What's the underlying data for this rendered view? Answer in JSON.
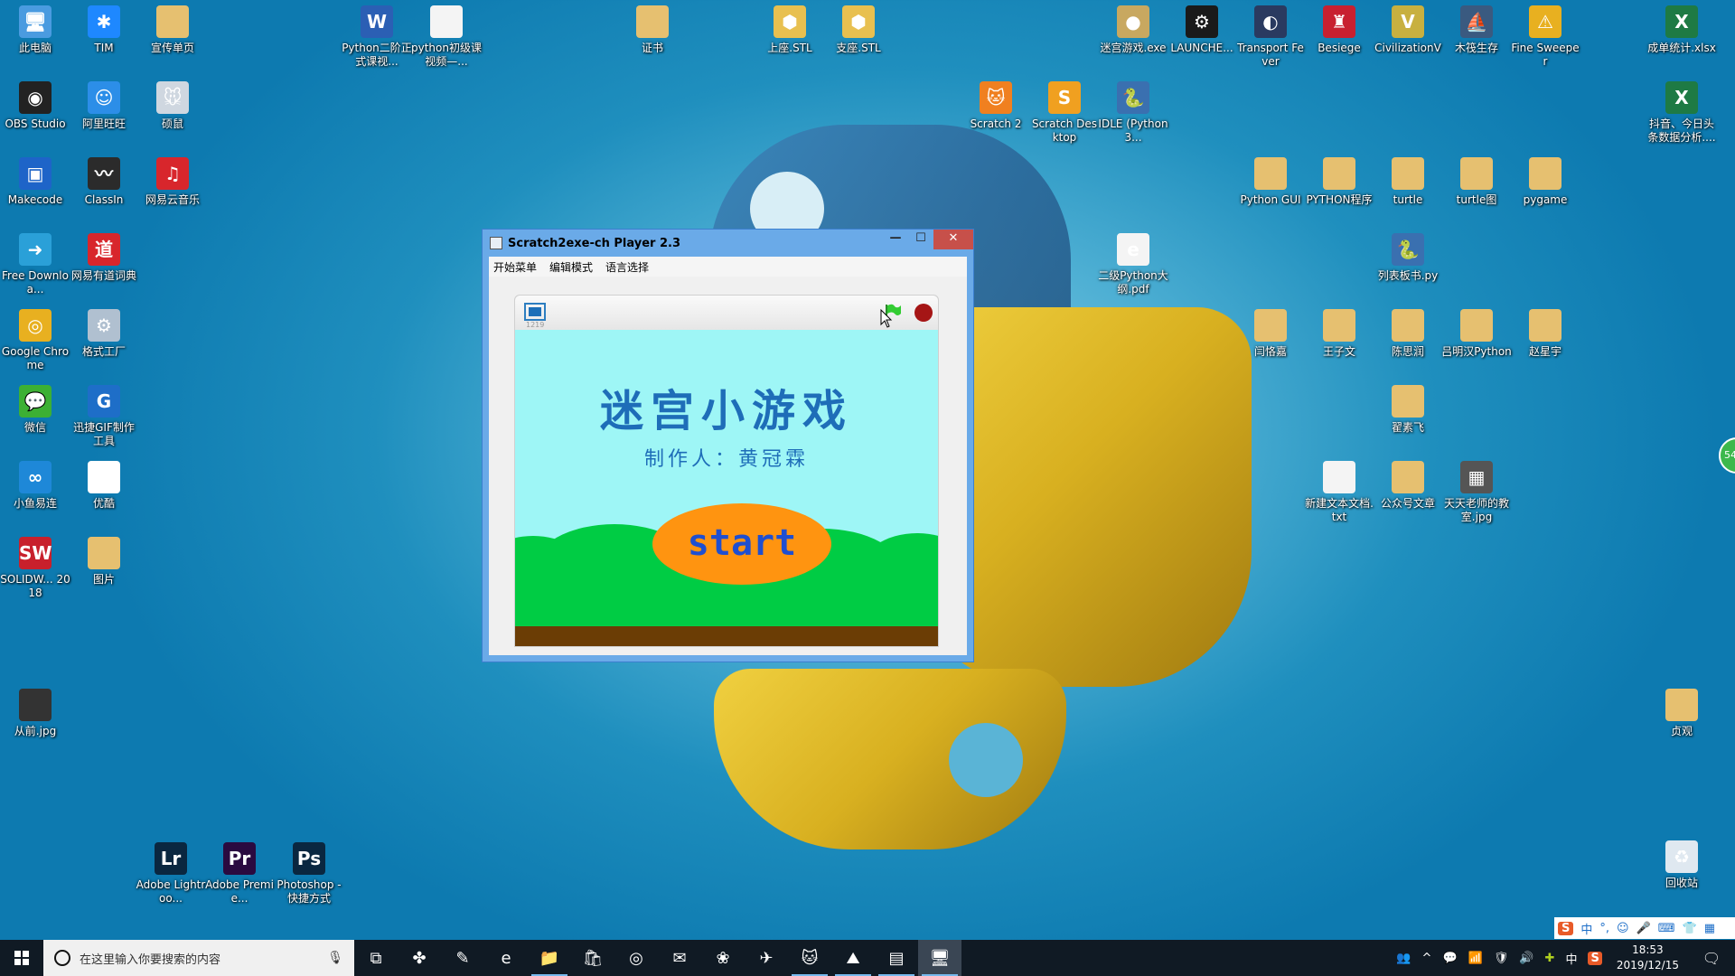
{
  "desktop": {
    "icons": [
      {
        "label": "此电脑",
        "icon": "computer-icon",
        "color": "#4a9be0",
        "glyph": "🖥"
      },
      {
        "label": "TIM",
        "icon": "tim-icon",
        "color": "#1e88ff",
        "glyph": "✱"
      },
      {
        "label": "宣传单页",
        "icon": "folder-icon",
        "color": "#e6c070",
        "glyph": ""
      },
      {
        "label": "OBS Studio",
        "icon": "obs-icon",
        "color": "#222",
        "glyph": "◉"
      },
      {
        "label": "阿里旺旺",
        "icon": "aliwangwang-icon",
        "color": "#2c8ee8",
        "glyph": "☺"
      },
      {
        "label": "硕鼠",
        "icon": "mouse-app-icon",
        "color": "#cfd7e0",
        "glyph": "🐭"
      },
      {
        "label": "Makecode",
        "icon": "makecode-icon",
        "color": "#1e64c8",
        "glyph": "▣"
      },
      {
        "label": "ClassIn",
        "icon": "classin-icon",
        "color": "#2b2b2b",
        "glyph": "〰"
      },
      {
        "label": "网易云音乐",
        "icon": "netease-music-icon",
        "color": "#d8262c",
        "glyph": "♫"
      },
      {
        "label": "Free Downloa...",
        "icon": "download-icon",
        "color": "#2aa0d8",
        "glyph": "➜"
      },
      {
        "label": "网易有道词典",
        "icon": "youdao-icon",
        "color": "#d8262c",
        "glyph": "道"
      },
      {
        "label": "Google Chrome",
        "icon": "chrome-icon",
        "color": "#e8b020",
        "glyph": "◎"
      },
      {
        "label": "格式工厂",
        "icon": "format-factory-icon",
        "color": "#b0c0d0",
        "glyph": "⚙"
      },
      {
        "label": "微信",
        "icon": "wechat-icon",
        "color": "#3cb034",
        "glyph": "💬"
      },
      {
        "label": "迅捷GIF制作工具",
        "icon": "gif-tool-icon",
        "color": "#1e6ec8",
        "glyph": "G"
      },
      {
        "label": "小鱼易连",
        "icon": "xylink-icon",
        "color": "#1e88d8",
        "glyph": "∞"
      },
      {
        "label": "优酷",
        "icon": "youku-icon",
        "color": "#fff",
        "glyph": "▶"
      },
      {
        "label": "SOLIDW... 2018",
        "icon": "solidworks-icon",
        "color": "#c8202c",
        "glyph": "SW"
      },
      {
        "label": "图片",
        "icon": "folder-icon",
        "color": "#e6c070",
        "glyph": ""
      },
      {
        "label": "从前.jpg",
        "icon": "image-file-icon",
        "color": "#333",
        "glyph": ""
      },
      {
        "label": "Adobe Lightroo...",
        "icon": "lightroom-icon",
        "color": "#0a2740",
        "glyph": "Lr"
      },
      {
        "label": "Adobe Premie...",
        "icon": "premiere-icon",
        "color": "#2a0a40",
        "glyph": "Pr"
      },
      {
        "label": "Photoshop - 快捷方式",
        "icon": "photoshop-icon",
        "color": "#0a2740",
        "glyph": "Ps"
      },
      {
        "label": "Python二阶正式课视...",
        "icon": "word-doc-icon",
        "color": "#2b5fb4",
        "glyph": "W"
      },
      {
        "label": "python初级课视频—...",
        "icon": "text-file-icon",
        "color": "#f4f4f4",
        "glyph": ""
      },
      {
        "label": "证书",
        "icon": "folder-icon",
        "color": "#e6c070",
        "glyph": ""
      },
      {
        "label": "上座.STL",
        "icon": "stl-file-icon",
        "color": "#e8c050",
        "glyph": "⬢"
      },
      {
        "label": "支座.STL",
        "icon": "stl-file-icon",
        "color": "#e8c050",
        "glyph": "⬢"
      },
      {
        "label": "迷宫游戏.exe",
        "icon": "maze-game-icon",
        "color": "#c8a860",
        "glyph": "●"
      },
      {
        "label": "LAUNCHE...",
        "icon": "steam-icon",
        "color": "#1a1a1a",
        "glyph": "⚙"
      },
      {
        "label": "Transport Fever",
        "icon": "transport-fever-icon",
        "color": "#2a3a60",
        "glyph": "◐"
      },
      {
        "label": "Besiege",
        "icon": "besiege-icon",
        "color": "#c82030",
        "glyph": "♜"
      },
      {
        "label": "CivilizationV",
        "icon": "civilization-icon",
        "color": "#c8b040",
        "glyph": "V"
      },
      {
        "label": "木筏生存",
        "icon": "raft-icon",
        "color": "#3a5a80",
        "glyph": "⛵"
      },
      {
        "label": "Fine Sweeper",
        "icon": "fine-sweeper-icon",
        "color": "#e8b020",
        "glyph": "⚠"
      },
      {
        "label": "成单统计.xlsx",
        "icon": "excel-icon",
        "color": "#1e7a44",
        "glyph": "X"
      },
      {
        "label": "抖音、今日头条数据分析....",
        "icon": "excel-icon",
        "color": "#1e7a44",
        "glyph": "X"
      },
      {
        "label": "Scratch 2",
        "icon": "scratch-icon",
        "color": "#f08020",
        "glyph": "🐱"
      },
      {
        "label": "Scratch Desktop",
        "icon": "scratch-desktop-icon",
        "color": "#f0a020",
        "glyph": "S"
      },
      {
        "label": "IDLE (Python 3...",
        "icon": "idle-icon",
        "color": "#3a70b0",
        "glyph": "🐍"
      },
      {
        "label": "二级Python大纲.pdf",
        "icon": "pdf-icon",
        "color": "#f4f4f4",
        "glyph": "e"
      },
      {
        "label": "Python GUI",
        "icon": "folder-icon",
        "color": "#e6c070",
        "glyph": ""
      },
      {
        "label": "PYTHON程序",
        "icon": "folder-icon",
        "color": "#e6c070",
        "glyph": ""
      },
      {
        "label": "turtle",
        "icon": "folder-icon",
        "color": "#e6c070",
        "glyph": ""
      },
      {
        "label": "turtle图",
        "icon": "folder-icon",
        "color": "#e6c070",
        "glyph": ""
      },
      {
        "label": "pygame",
        "icon": "folder-icon",
        "color": "#e6c070",
        "glyph": ""
      },
      {
        "label": "列表板书.py",
        "icon": "python-file-icon",
        "color": "#3a70b0",
        "glyph": "🐍"
      },
      {
        "label": "闫恪嘉",
        "icon": "folder-icon",
        "color": "#e6c070",
        "glyph": ""
      },
      {
        "label": "王子文",
        "icon": "folder-icon",
        "color": "#e6c070",
        "glyph": ""
      },
      {
        "label": "陈思润",
        "icon": "folder-icon",
        "color": "#e6c070",
        "glyph": ""
      },
      {
        "label": "吕明汉Python",
        "icon": "folder-icon",
        "color": "#e6c070",
        "glyph": ""
      },
      {
        "label": "赵星宇",
        "icon": "folder-icon",
        "color": "#e6c070",
        "glyph": ""
      },
      {
        "label": "翟素飞",
        "icon": "folder-icon",
        "color": "#e6c070",
        "glyph": ""
      },
      {
        "label": "新建文本文档.txt",
        "icon": "text-file-icon",
        "color": "#f4f4f4",
        "glyph": ""
      },
      {
        "label": "公众号文章",
        "icon": "folder-icon",
        "color": "#e6c070",
        "glyph": ""
      },
      {
        "label": "天天老师的教室.jpg",
        "icon": "qr-image-icon",
        "color": "#555",
        "glyph": "▦"
      },
      {
        "label": "贞观",
        "icon": "folder-icon",
        "color": "#e6c070",
        "glyph": ""
      },
      {
        "label": "回收站",
        "icon": "recycle-bin-icon",
        "color": "#dfe8f0",
        "glyph": "♻"
      }
    ],
    "side_widget": "54"
  },
  "window": {
    "title": "Scratch2exe-ch Player 2.3",
    "minimize": "—",
    "maximize": "☐",
    "close": "✕",
    "menu": [
      "开始菜单",
      "编辑模式",
      "语言选择"
    ],
    "player": {
      "fullscreen_label": "1219",
      "green_flag_color": "#33cc33",
      "stop_color": "#a51515"
    },
    "stage": {
      "title": "迷宫小游戏",
      "subtitle": "制作人：黄冠霖",
      "start_button": "start"
    }
  },
  "taskbar": {
    "search_placeholder": "在这里输入你要搜索的内容",
    "apps": [
      {
        "name": "task-view",
        "glyph": "⧉"
      },
      {
        "name": "fan-app",
        "glyph": "✤"
      },
      {
        "name": "paint-app",
        "glyph": "✎"
      },
      {
        "name": "edge",
        "glyph": "e"
      },
      {
        "name": "file-explorer",
        "glyph": "📁"
      },
      {
        "name": "store",
        "glyph": "🛍"
      },
      {
        "name": "chrome",
        "glyph": "◎"
      },
      {
        "name": "mail",
        "glyph": "✉"
      },
      {
        "name": "app-flower",
        "glyph": "❀"
      },
      {
        "name": "feishu",
        "glyph": "✈"
      },
      {
        "name": "scratch",
        "glyph": "🐱"
      },
      {
        "name": "photos",
        "glyph": "⛰"
      },
      {
        "name": "notepad",
        "glyph": "▤"
      },
      {
        "name": "scratch-player",
        "glyph": "🖥"
      }
    ],
    "tray": {
      "people": "👥",
      "chevron": "^",
      "wechat": "💬",
      "wifi": "📶",
      "security": "🛡",
      "volume": "🔊",
      "app360": "✚",
      "ime_lang": "中",
      "sogou": "S",
      "time": "18:53",
      "date": "2019/12/15",
      "notifications": "🗨"
    },
    "ime_bar": [
      "S",
      "中",
      "°,",
      "☺",
      "🎤",
      "⌨",
      "👕",
      "▦"
    ]
  }
}
